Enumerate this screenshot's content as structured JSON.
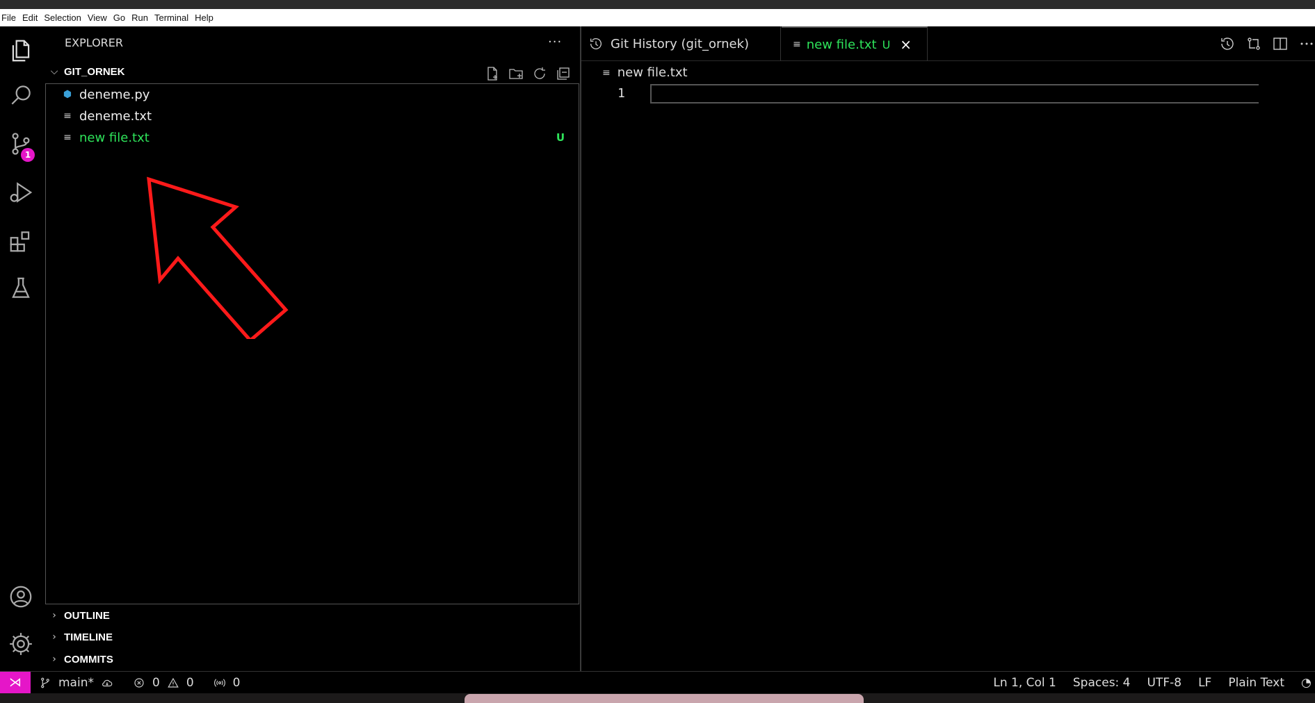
{
  "menu": [
    "File",
    "Edit",
    "Selection",
    "View",
    "Go",
    "Run",
    "Terminal",
    "Help"
  ],
  "activity": {
    "badge": "1",
    "items": [
      "explorer-icon",
      "search-icon",
      "source-control-icon",
      "run-debug-icon",
      "extensions-icon",
      "testing-icon",
      "account-icon",
      "gear-icon"
    ]
  },
  "sidebar": {
    "title": "EXPLORER",
    "more": "···",
    "folder": "GIT_ORNEK",
    "files": [
      {
        "name": "deneme.py",
        "icon": "python-icon",
        "status": ""
      },
      {
        "name": "deneme.txt",
        "icon": "text-file-icon",
        "status": ""
      },
      {
        "name": "new file.txt",
        "icon": "text-file-icon",
        "status": "U"
      }
    ],
    "sections": [
      "OUTLINE",
      "TIMELINE",
      "COMMITS"
    ]
  },
  "editor": {
    "tabs": [
      {
        "label": "Git History (git_ornek)"
      },
      {
        "label": "new file.txt",
        "status": "U",
        "close": "×"
      }
    ],
    "breadcrumb": "new file.txt",
    "line_number": "1"
  },
  "statusbar": {
    "branch": "main*",
    "errors": "0",
    "warnings": "0",
    "ports": "0",
    "position": "Ln 1, Col 1",
    "spaces": "Spaces: 4",
    "encoding": "UTF-8",
    "eol": "LF",
    "language": "Plain Text"
  },
  "colors": {
    "accent": "#e516c8",
    "untracked": "#2ee35a",
    "annotation_arrow": "#ff1a1a"
  }
}
